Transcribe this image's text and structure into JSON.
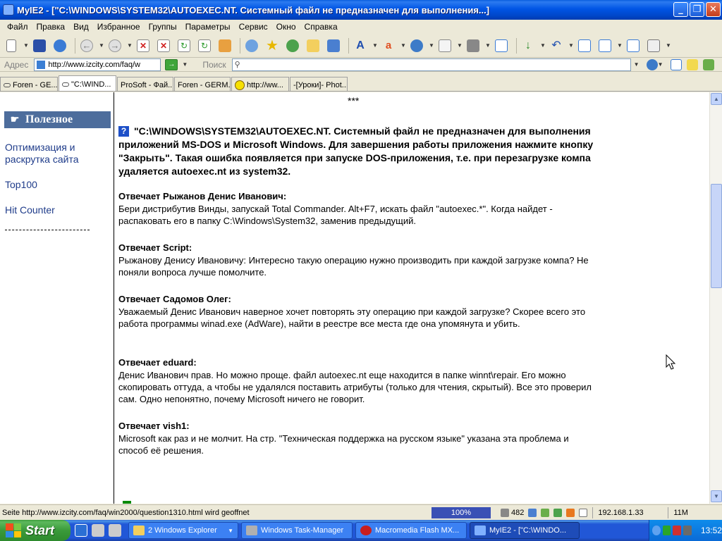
{
  "window": {
    "title": "MyIE2 - [\"C:\\WINDOWS\\SYSTEM32\\AUTOEXEC.NT. Системный файл не предназначен для выполнения...]",
    "minimize": "_",
    "maximize": "❐",
    "close": "✕"
  },
  "menu": [
    "Файл",
    "Правка",
    "Вид",
    "Избранное",
    "Группы",
    "Параметры",
    "Сервис",
    "Окно",
    "Справка"
  ],
  "addressbar": {
    "label": "Адрес",
    "url": "http://www.izcity.com/faq/w",
    "search_label": "Поиск"
  },
  "tabs": [
    {
      "label": "Foren - GE...",
      "active": false
    },
    {
      "label": "\"C:\\WIND...",
      "active": true
    },
    {
      "label": "ProSoft - Фай...",
      "active": false
    },
    {
      "label": "Foren - GERM...",
      "active": false
    },
    {
      "label": "http://ww...",
      "active": false
    },
    {
      "label": "-[Уроки]- Phot...",
      "active": false
    }
  ],
  "sidebar": {
    "heading": "Полезное",
    "links": [
      "Оптимизация и раскрутка сайта",
      "Top100",
      "Hit Counter"
    ]
  },
  "article": {
    "stars": "***",
    "qmark": "?",
    "question": "\"C:\\WINDOWS\\SYSTEM32\\AUTOEXEC.NT. Системный файл не предназначен для выполнения приложений MS-DOS и Microsoft Windows. Для завершения работы приложения нажмите кнопку \"Закрыть\". Такая ошибка появляется при запуске DOS-приложения, т.е. при перезагрузке компа удаляется autoexec.nt из system32.",
    "answers": [
      {
        "head": "Отвечает Рыжанов Денис Иванович:",
        "text": "Бери дистрибутив Винды, запускай Total Commander. Alt+F7, искать файл \"autoexec.*\". Когда найдет - распаковать его в папку C:\\Windows\\System32, заменив предыдущий."
      },
      {
        "head": "Отвечает Script:",
        "text": "Рыжанову Денису Ивановичу: Интересно такую операцию нужно производить при каждой загрузке компа? Не поняли вопроса лучше помолчите."
      },
      {
        "head": "Отвечает Садомов Олег:",
        "text": "Уважаемый Денис Иванович наверное хочет повторять эту операцию при каждой загрузке? Скорее всего это работа программы winad.exe (AdWare), найти в реестре все места где она упомянута и убить."
      },
      {
        "head": "Отвечает eduard:",
        "text": "Денис Иванович прав. Но можно проще. файл autoexec.nt еще находится в папке winnt\\repair. Его можно скопировать оттуда, а чтобы не удалялся поставить атрибуты (только для чтения, скрытый). Все это проверил сам. Одно непонятно, почему Microsoft ничего не говорит."
      },
      {
        "head": "Отвечает vish1:",
        "text": "Microsoft как раз и не молчит. На стр. \"Техническая поддержка на русском языке\" указана эта проблема и способ её решения."
      }
    ]
  },
  "statusbar": {
    "text": "Seite http://www.izcity.com/faq/win2000/question1310.html wird geoffnet",
    "zoom": "100%",
    "count": "482",
    "ip": "192.168.1.33",
    "memory": "11M"
  },
  "taskbar": {
    "start": "Start",
    "tasks": [
      {
        "label": "2 Windows Explorer",
        "active": false
      },
      {
        "label": "Windows Task-Manager",
        "active": false
      },
      {
        "label": "Macromedia Flash MX...",
        "active": false
      },
      {
        "label": "MyIE2 - [\"C:\\WINDO...",
        "active": true
      }
    ],
    "clock": "13:52"
  },
  "colors": {
    "titlebar": "#0055E5",
    "sidebar_heading_bg": "#4D6D9C",
    "link": "#1F3C8A",
    "zoom_bg": "#3A50B5",
    "taskbar": "#2157D7",
    "start_button": "#3A9A3A"
  }
}
